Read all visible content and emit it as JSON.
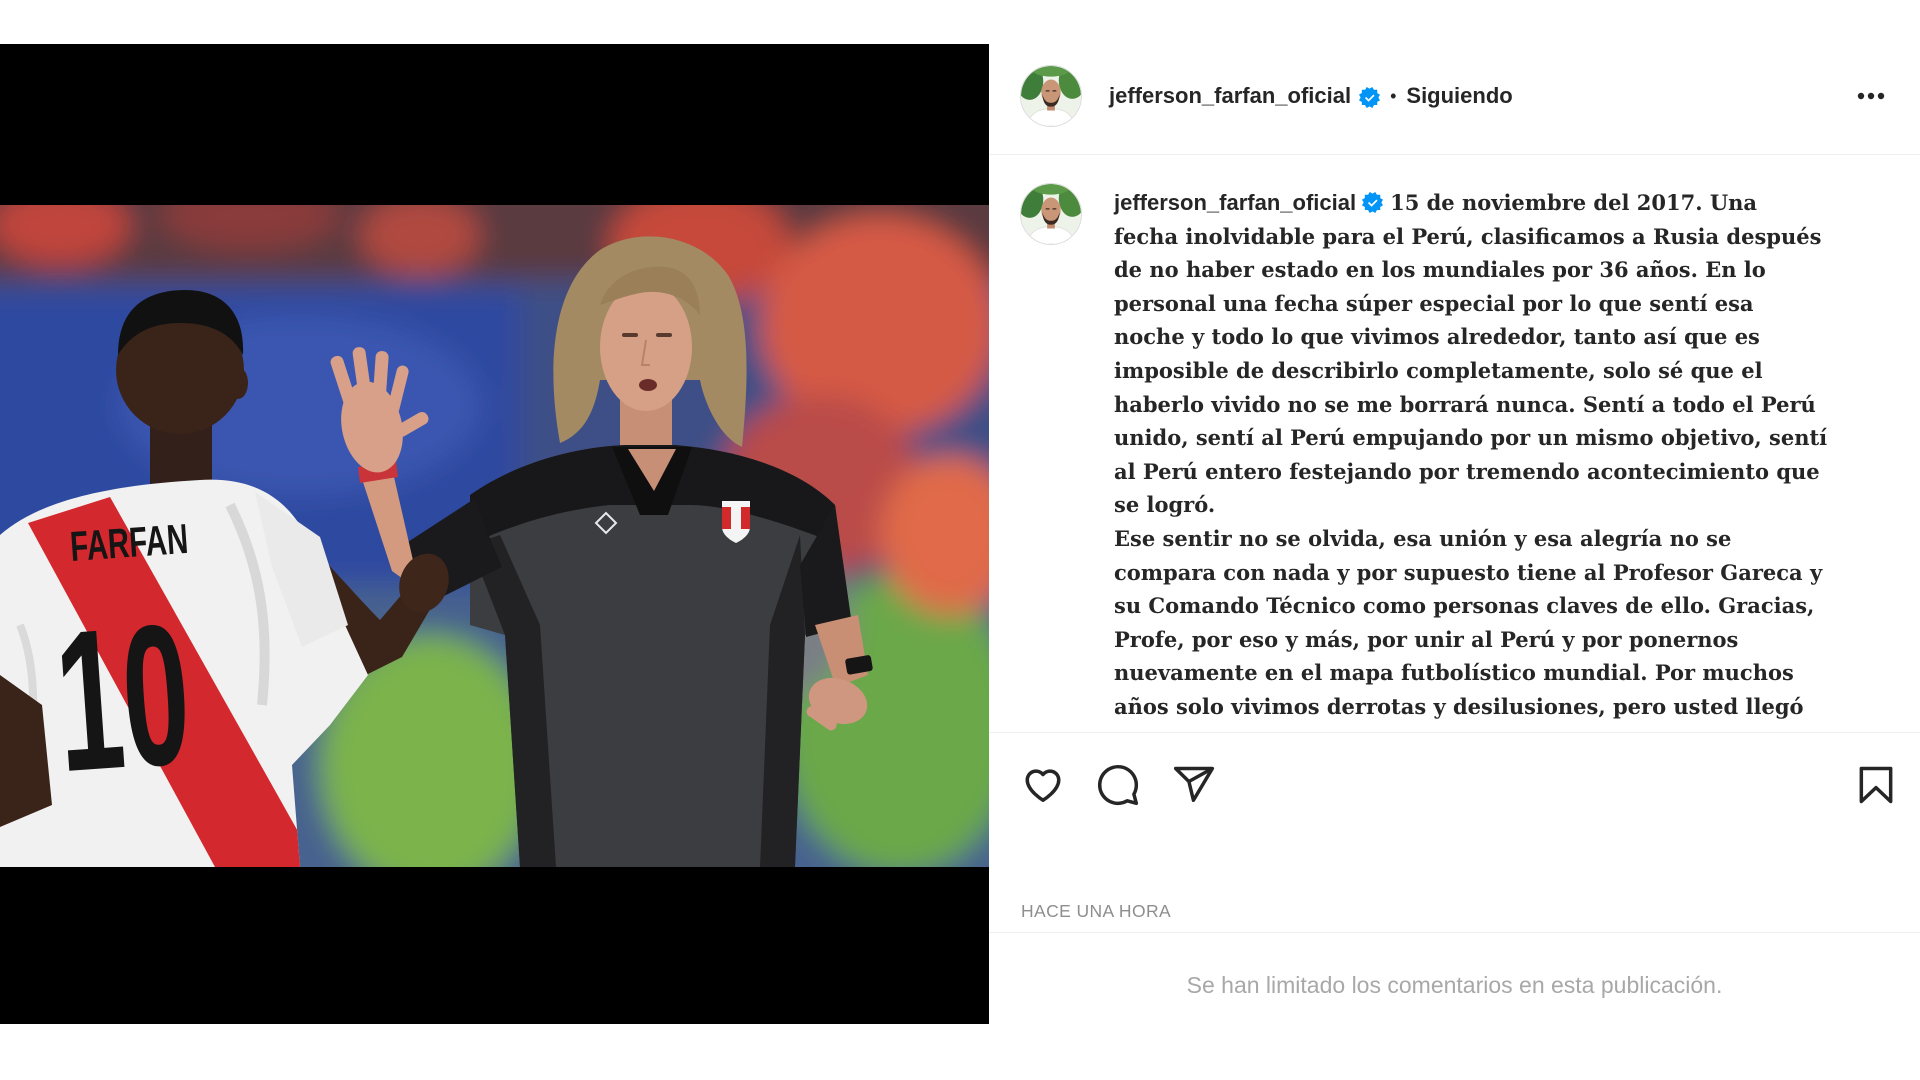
{
  "colors": {
    "verified": "#0095f6",
    "text": "#262626",
    "muted": "#8e8e8e",
    "divider": "#efefef",
    "sash_red": "#d3282d"
  },
  "photo": {
    "jersey_name": "FARFAN",
    "jersey_number": "10"
  },
  "header": {
    "avatar_icon": "profile-avatar",
    "username": "jefferson_farfan_oficial",
    "verified_icon": "verified-badge-icon",
    "separator": "•",
    "follow_status": "Siguiendo",
    "more_icon": "more-horizontal-icon"
  },
  "caption": {
    "username": "jefferson_farfan_oficial",
    "lines": [
      "15 de noviembre del 2017. Una",
      "fecha inolvidable para el Perú, clasificamos a Rusia después",
      "de no haber estado en los mundiales por 36 años. En lo",
      "personal una fecha súper especial por lo que sentí esa",
      "noche y todo lo que vivimos alrededor, tanto así que es",
      "imposible de describirlo completamente, solo sé que el",
      "haberlo vivido no se me borrará nunca. Sentí a todo el Perú",
      "unido, sentí al Perú empujando por un mismo objetivo, sentí",
      "al Perú entero festejando por tremendo acontecimiento que",
      "se logró.",
      "Ese sentir no se olvida, esa unión y esa alegría no se",
      "compara con nada y por supuesto tiene al Profesor Gareca y",
      "su Comando Técnico como personas claves de ello. Gracias,",
      "Profe, por eso y más, por unir al Perú y por ponernos",
      "nuevamente en el mapa futbolístico mundial. Por muchos",
      "años solo vivimos derrotas y desilusiones, pero usted llegó"
    ]
  },
  "actions": {
    "like_icon": "heart-icon",
    "comment_icon": "comment-icon",
    "share_icon": "share-icon",
    "save_icon": "bookmark-icon"
  },
  "timestamp": "HACE UNA HORA",
  "comments_notice": "Se han limitado los comentarios en esta publicación."
}
